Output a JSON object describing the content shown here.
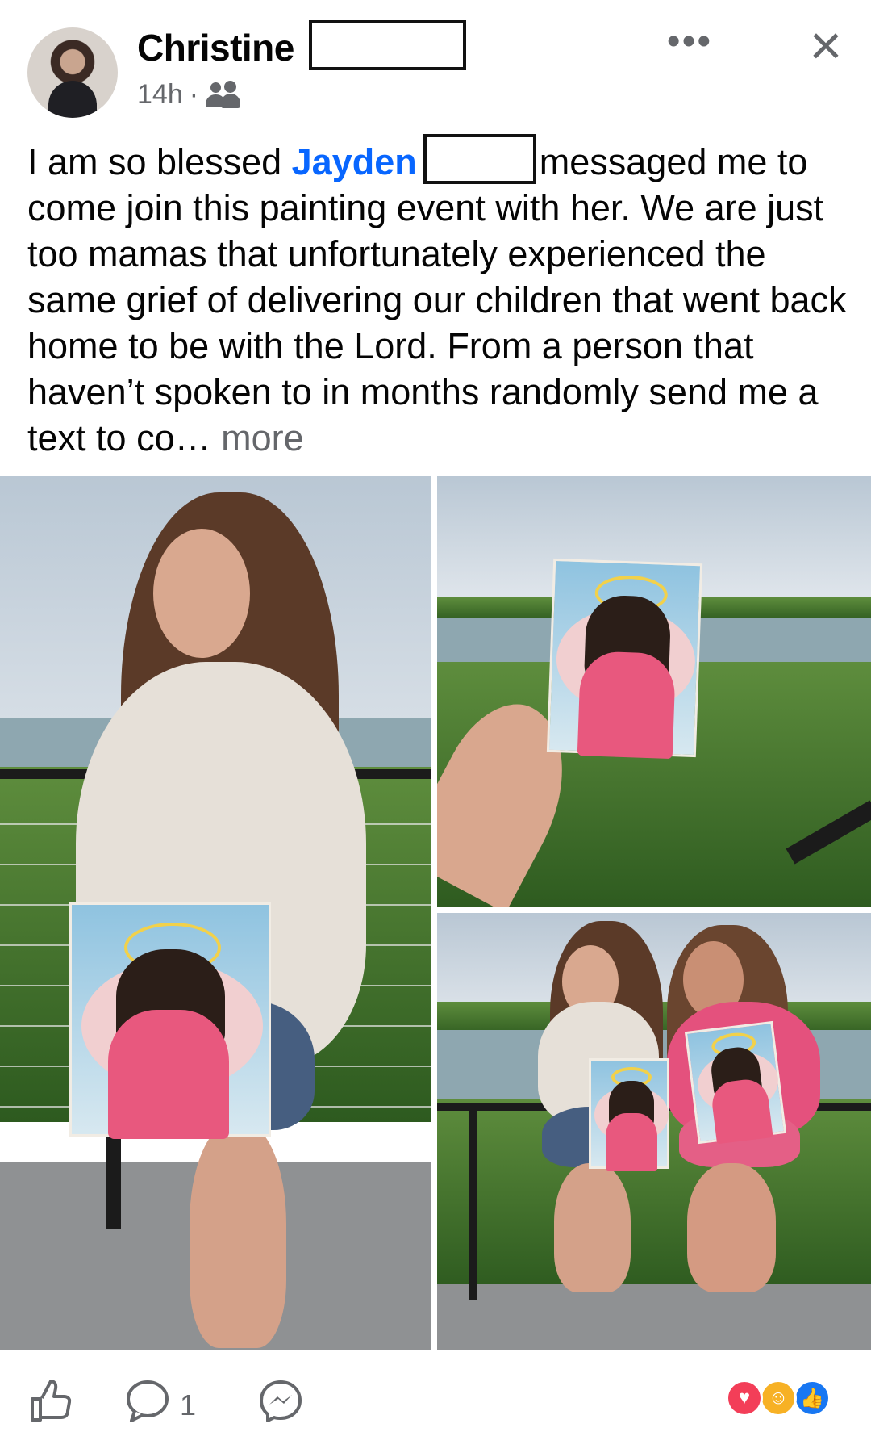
{
  "post": {
    "author": "Christine",
    "time": "14h",
    "separator": "·",
    "audience_icon": "friends-icon",
    "text_before_mention": "I am so blessed ",
    "mention": "Jayden",
    "text_after_mention": "messaged me to come join this painting event with her. We are just too mamas that unfortunately experienced the same grief of delivering our children that went back home to be with the Lord. From a person that haven’t spoken to in months randomly send me a text to co…",
    "see_more": " more"
  },
  "actions": {
    "like_icon": "thumbs-up-icon",
    "comment_icon": "comment-icon",
    "comment_count": "1",
    "messenger_icon": "messenger-icon",
    "reaction_icons": [
      "love-reaction-icon",
      "care-reaction-icon",
      "like-reaction-icon"
    ]
  },
  "colors": {
    "accent": "#0866ff",
    "secondary_text": "#65676b",
    "love": "#f33e58",
    "care": "#f7b125",
    "like": "#1877f2"
  }
}
